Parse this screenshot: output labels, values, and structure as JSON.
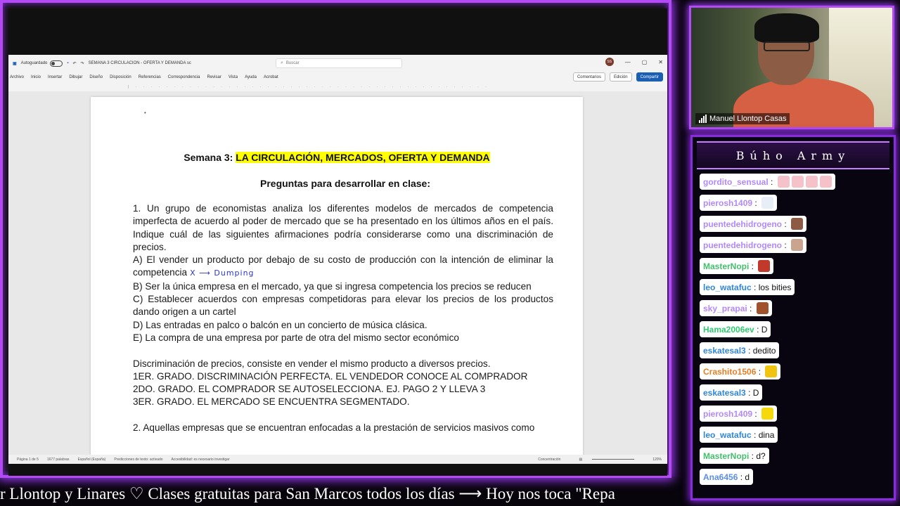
{
  "word": {
    "autosave_label": "Autoguardado",
    "doc_title": "SEMANA 3 CIRCULACION - OFERTA Y DEMANDA sc",
    "search_placeholder": "Buscar",
    "user_initials": "SS",
    "menu": [
      "Archivo",
      "Inicio",
      "Insertar",
      "Dibujar",
      "Diseño",
      "Disposición",
      "Referencias",
      "Correspondencia",
      "Revisar",
      "Vista",
      "Ayuda",
      "Acrobat"
    ],
    "comments_label": "Comentarios",
    "editing_label": "Edición",
    "share_label": "Compartir"
  },
  "document": {
    "title_prefix": "Semana 3:",
    "title_highlight": "LA CIRCULACIÓN, MERCADOS, OFERTA Y DEMANDA",
    "subtitle": "Preguntas para desarrollar en clase:",
    "q1": "1. Un grupo de economistas analiza los diferentes modelos de mercados de competencia imperfecta de acuerdo al poder de mercado que se ha presentado en los últimos años en el país. Indique cuál de las siguientes afirmaciones podría considerarse como una discriminación de precios.",
    "optA": "A) El vender un producto por debajo de su costo de producción con la intención de eliminar la competencia",
    "optA_note": "X ⟶ Dumping",
    "optB": "B) Ser la única empresa en el mercado, ya que si ingresa competencia los precios se reducen",
    "optC": "C) Establecer acuerdos con empresas competidoras para elevar los precios de los productos dando origen a un cartel",
    "optD": "D) Las entradas en palco o balcón en un concierto de música clásica.",
    "optE": "E) La compra de una empresa por parte de otra del mismo sector económico",
    "def": "Discriminación de precios, consiste en vender el mismo producto a diversos precios.",
    "g1": "1ER. GRADO. DISCRIMINACIÓN PERFECTA. EL VENDEDOR CONOCE AL COMPRADOR",
    "g2": "2DO. GRADO. EL COMPRADOR SE AUTOSELECCIONA. EJ. PAGO 2 Y LLEVA 3",
    "g3": "3ER. GRADO. EL MERCADO SE ENCUENTRA SEGMENTADO.",
    "q2": "2. Aquellas empresas que se encuentran enfocadas a la prestación de servicios masivos como"
  },
  "status": {
    "page": "Página 1 de 5",
    "words": "1677 palabras",
    "language": "Español (España)",
    "predictions": "Predicciones de texto: activado",
    "accessibility": "Accesibilidad: es necesario investigar",
    "focus": "Concentración",
    "zoom": "120%"
  },
  "webcam": {
    "name": "Manuel Llontop Casas"
  },
  "chat": {
    "title": "Búho Army",
    "messages": [
      {
        "user": "gordito_sensual",
        "text": "",
        "emotes": [
          "#f4c2c8",
          "#f4c2c8",
          "#f4c2c8",
          "#f4c2c8"
        ],
        "color": "#b388ff"
      },
      {
        "user": "pierosh1409",
        "text": "",
        "emotes": [
          "#e8eef5"
        ],
        "color": "#b388ff"
      },
      {
        "user": "puentedehidrogeno",
        "text": "",
        "emotes": [
          "#8d5a43"
        ],
        "color": "#b388ff"
      },
      {
        "user": "puentedehidrogeno",
        "text": "",
        "emotes": [
          "#c9a58f"
        ],
        "color": "#b388ff"
      },
      {
        "user": "MasterNopi",
        "text": "",
        "emotes": [
          "#c0392b"
        ],
        "color": "#43c06b"
      },
      {
        "user": "leo_watafuc",
        "text": "los bities",
        "emotes": [],
        "color": "#2e86de"
      },
      {
        "user": "sky_prapai",
        "text": "",
        "emotes": [
          "#a0522d"
        ],
        "color": "#b388ff"
      },
      {
        "user": "Hama2006ev",
        "text": "D",
        "emotes": [],
        "color": "#2ecc71"
      },
      {
        "user": "eskatesal3",
        "text": "dedito",
        "emotes": [],
        "color": "#2e86de"
      },
      {
        "user": "Crashito1506",
        "text": "",
        "emotes": [
          "#f1c40f"
        ],
        "color": "#e67e22"
      },
      {
        "user": "eskatesal3",
        "text": "D",
        "emotes": [],
        "color": "#2e86de"
      },
      {
        "user": "pierosh1409",
        "text": "",
        "emotes": [
          "#f5d90a"
        ],
        "color": "#b388ff"
      },
      {
        "user": "leo_watafuc",
        "text": "dina",
        "emotes": [],
        "color": "#2e86de"
      },
      {
        "user": "MasterNopi",
        "text": "d?",
        "emotes": [],
        "color": "#43c06b"
      },
      {
        "user": "Ana6456",
        "text": "d",
        "emotes": [],
        "color": "#5b8def"
      }
    ]
  },
  "ticker": {
    "text": "r Llontop y Linares ♡    Clases gratuitas para San Marcos todos los días  ⟶  Hoy nos toca \"Repa"
  }
}
